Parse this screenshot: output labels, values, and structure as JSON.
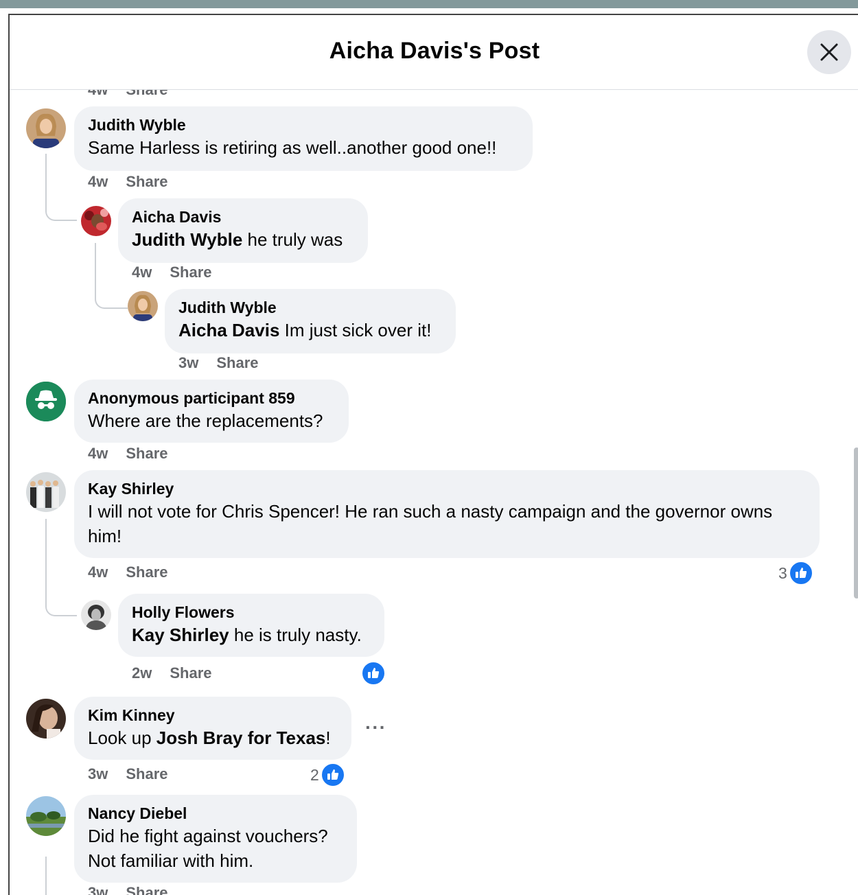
{
  "header": {
    "title": "Aicha Davis's Post",
    "close_label": "close"
  },
  "share_label": "Share",
  "partial_top": {
    "time": "4w",
    "share": "Share"
  },
  "comments": [
    {
      "name": "Judith Wyble",
      "text": "Same Harless is retiring as well..another good one!!",
      "time": "4w"
    },
    {
      "name": "Aicha Davis",
      "mention": "Judith Wyble",
      "text": " he truly was",
      "time": "4w"
    },
    {
      "name": "Judith Wyble",
      "mention": "Aicha Davis",
      "text": " Im just sick over it!",
      "time": "3w"
    },
    {
      "name": "Anonymous participant 859",
      "text": "Where are the replacements?",
      "time": "4w"
    },
    {
      "name": "Kay Shirley",
      "text": "I will not vote for Chris Spencer! He ran such a nasty campaign and the governor owns him!",
      "time": "4w",
      "reactions": "3"
    },
    {
      "name": "Holly Flowers",
      "mention": "Kay Shirley",
      "text": " he is truly nasty.",
      "time": "2w"
    },
    {
      "name": "Kim Kinney",
      "text_before": "Look up ",
      "mention": "Josh Bray for Texas",
      "text_after": "!",
      "time": "3w",
      "reactions": "2"
    },
    {
      "name": "Nancy Diebel",
      "text": "Did he fight against vouchers? Not familiar with him.",
      "time": "3w"
    }
  ],
  "more_options": "···",
  "colors": {
    "like_blue": "#1877f2",
    "bubble": "#f0f2f5",
    "meta_gray": "#65676b",
    "anon_green": "#1b8a5a"
  }
}
